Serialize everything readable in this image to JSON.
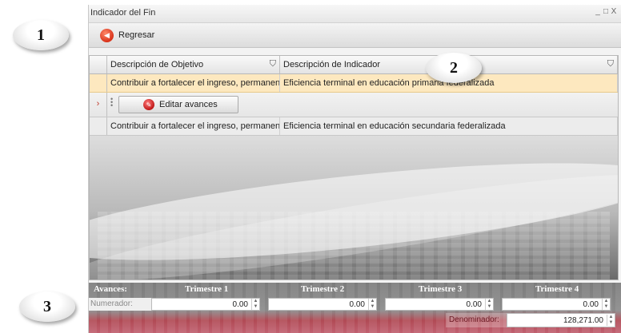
{
  "window": {
    "title": "Indicador del Fin",
    "controls": [
      "_",
      "□",
      "X"
    ]
  },
  "toolbar": {
    "back_label": "Regresar"
  },
  "grid": {
    "columns": [
      "Descripción de Objetivo",
      "Descripción de Indicador"
    ],
    "rows": [
      {
        "objetivo": "Contribuir a fortalecer el ingreso, permanencia",
        "indicador": "Eficiencia terminal en educación primaria federalizada"
      },
      {
        "objetivo": "Contribuir a fortalecer el ingreso, permanencia",
        "indicador": "Eficiencia terminal en educación secundaria federalizada"
      }
    ],
    "edit_button_label": "Editar avances"
  },
  "avances": {
    "label": "Avances:",
    "quarters": [
      "Trimestre 1",
      "Trimestre 2",
      "Trimestre 3",
      "Trimestre 4"
    ],
    "numerador_label": "Numerador:",
    "numerador_values": [
      "0.00",
      "0.00",
      "0.00",
      "0.00"
    ],
    "denominador_label": "Denominador:",
    "denominador_value": "128,271.00"
  },
  "callouts": [
    "1",
    "2",
    "3"
  ],
  "colors": {
    "selected_row": "#fde8bf",
    "accent_red": "#c0392b"
  }
}
